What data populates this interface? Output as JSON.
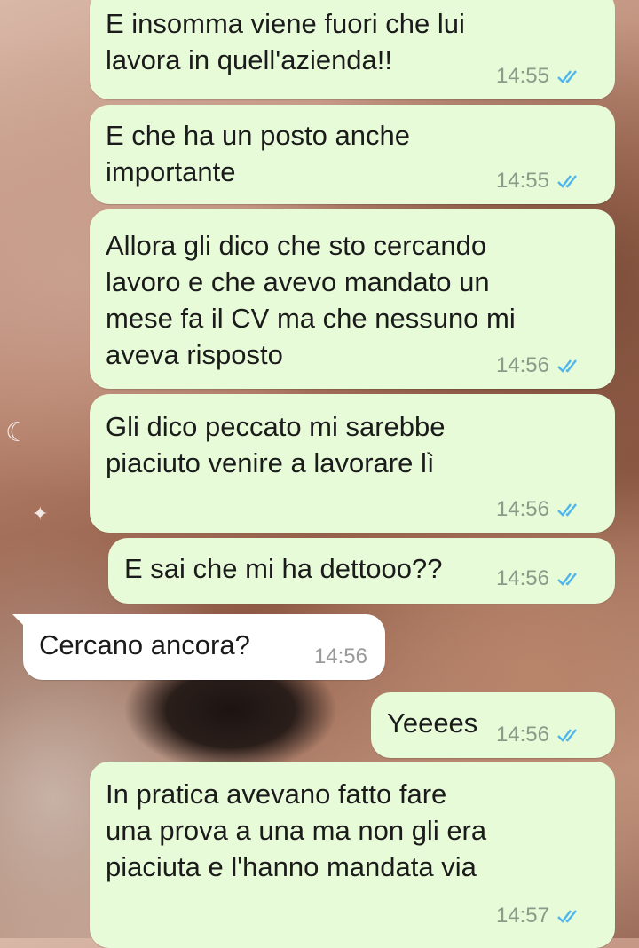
{
  "messages": [
    {
      "direction": "outgoing",
      "text": "E insomma viene fuori che lui\nlavora in quell'azienda!!",
      "time": "14:55",
      "status": "read"
    },
    {
      "direction": "outgoing",
      "text": "E che ha un posto anche\nimportante",
      "time": "14:55",
      "status": "read"
    },
    {
      "direction": "outgoing",
      "text": "Allora gli dico che sto cercando\nlavoro e che avevo mandato un\nmese fa il CV ma che nessuno mi\naveva risposto",
      "time": "14:56",
      "status": "read"
    },
    {
      "direction": "outgoing",
      "text": "Gli dico peccato mi sarebbe\npiaciuto venire a lavorare lì",
      "time": "14:56",
      "status": "read"
    },
    {
      "direction": "outgoing",
      "text": "E sai che mi ha dettooo??",
      "time": "14:56",
      "status": "read"
    },
    {
      "direction": "incoming",
      "text": "Cercano ancora?",
      "time": "14:56"
    },
    {
      "direction": "outgoing",
      "text": "Yeeees",
      "time": "14:56",
      "status": "read"
    },
    {
      "direction": "outgoing",
      "text": "In pratica avevano fatto fare\nuna prova a una ma non gli era\npiaciuta e l'hanno mandata via",
      "time": "14:57",
      "status": "read"
    }
  ],
  "icons": {
    "read_receipt": "double-check-icon"
  },
  "colors": {
    "outgoing_bubble": "#e7fbd8",
    "incoming_bubble": "#ffffff",
    "read_tick": "#4fb6ec",
    "time_text": "#8c9a8a"
  }
}
